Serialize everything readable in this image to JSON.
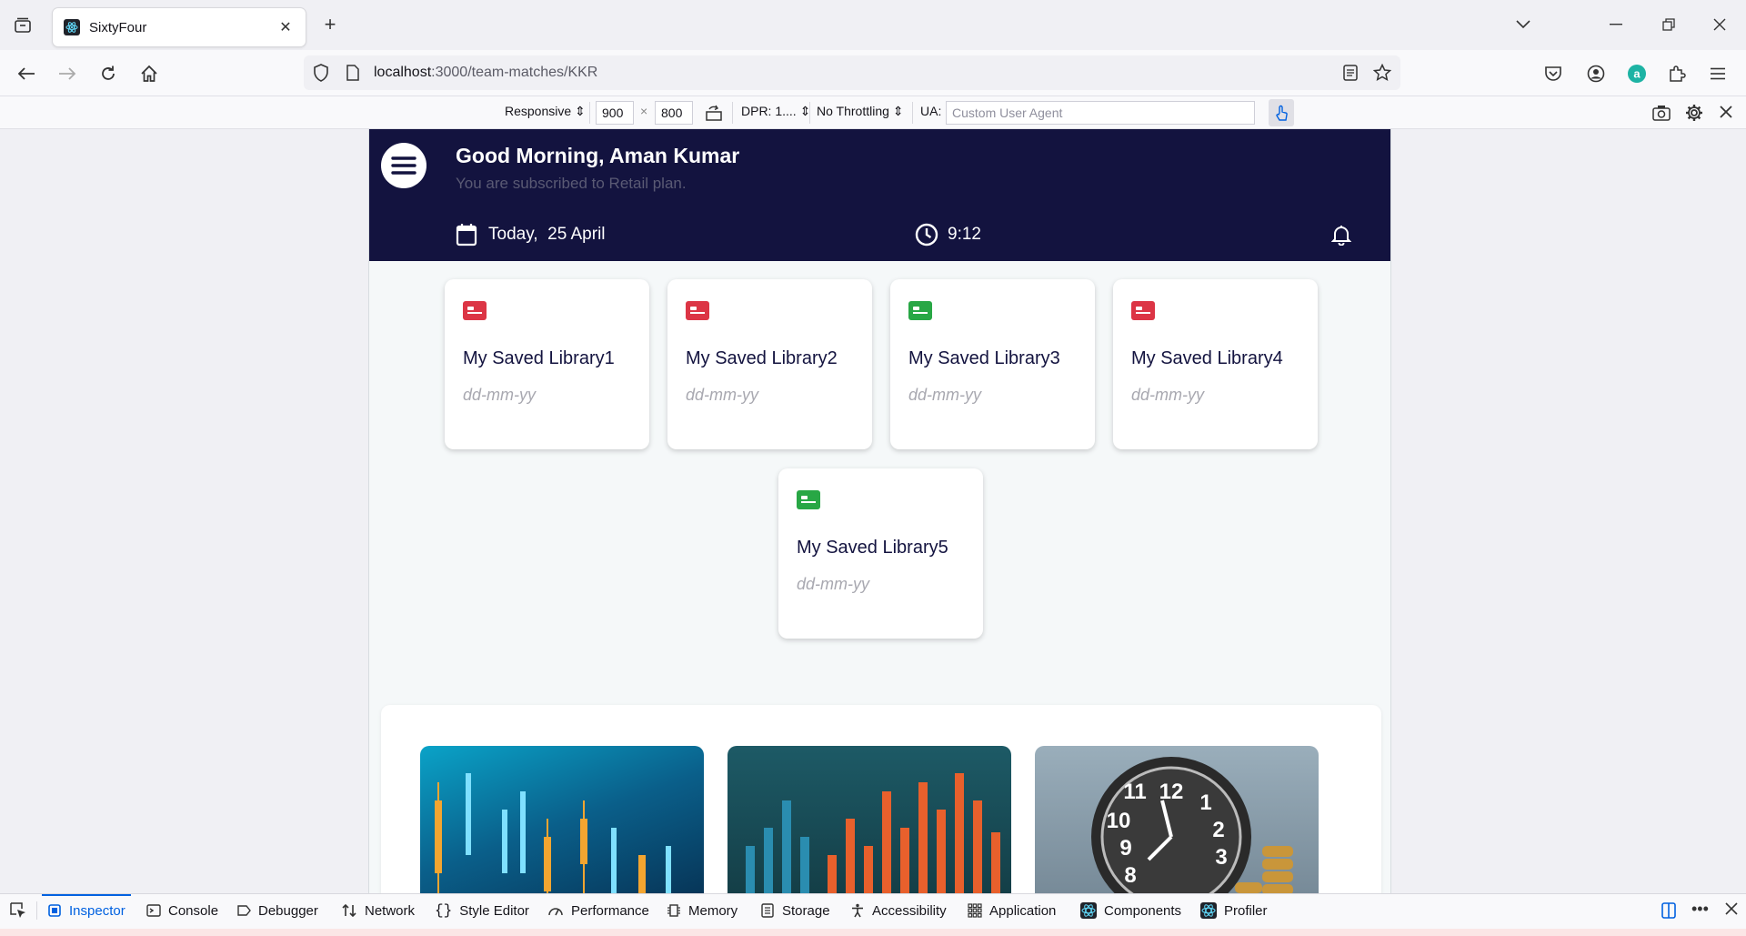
{
  "browser": {
    "tab_title": "SixtyFour",
    "url_host": "localhost",
    "url_rest": ":3000/team-matches/KKR"
  },
  "rdm": {
    "device": "Responsive",
    "width": "900",
    "height": "800",
    "times": "×",
    "dpr": "DPR: 1....",
    "throttling": "No Throttling",
    "ua_label": "UA:",
    "ua_placeholder": "Custom User Agent"
  },
  "header": {
    "greeting": "Good Morning, Aman Kumar",
    "subscription": "You are subscribed to Retail plan.",
    "date_prefix": "Today,",
    "date": "25 April",
    "time": "9:12"
  },
  "libraries": [
    {
      "name": "My Saved Library1",
      "date": "dd-mm-yy",
      "color": "#dc3545"
    },
    {
      "name": "My Saved Library2",
      "date": "dd-mm-yy",
      "color": "#dc3545"
    },
    {
      "name": "My Saved Library3",
      "date": "dd-mm-yy",
      "color": "#28a745"
    },
    {
      "name": "My Saved Library4",
      "date": "dd-mm-yy",
      "color": "#dc3545"
    },
    {
      "name": "My Saved Library5",
      "date": "dd-mm-yy",
      "color": "#28a745"
    }
  ],
  "devtools": {
    "tabs": [
      "Inspector",
      "Console",
      "Debugger",
      "Network",
      "Style Editor",
      "Performance",
      "Memory",
      "Storage",
      "Accessibility",
      "Application",
      "Components",
      "Profiler"
    ]
  }
}
